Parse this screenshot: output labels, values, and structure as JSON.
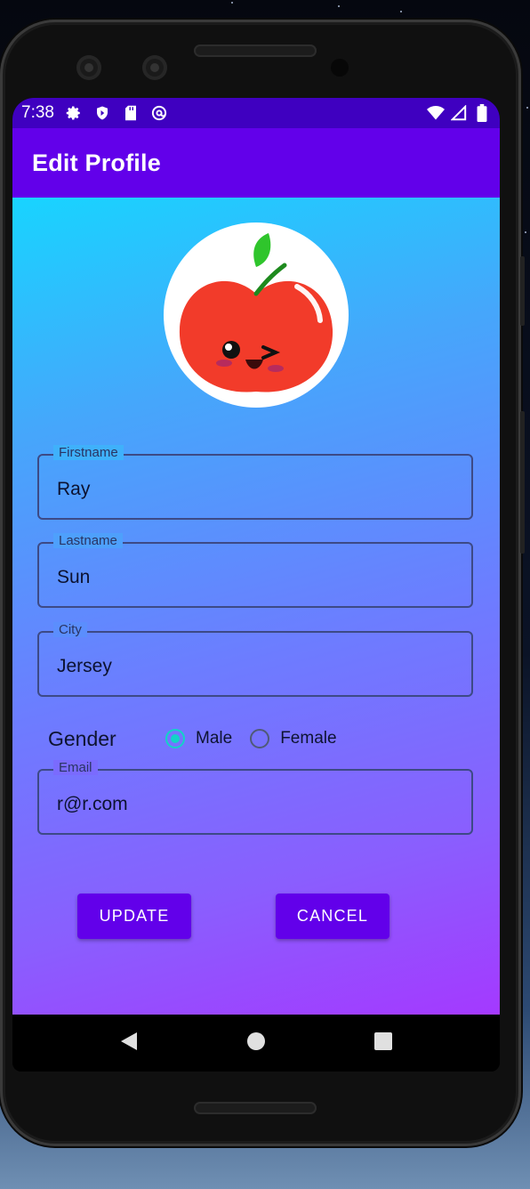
{
  "status_bar": {
    "time": "7:38",
    "left_icons": [
      "gear-icon",
      "shield-icon",
      "sd-card-icon",
      "at-sign-icon"
    ],
    "right_icons": [
      "wifi-icon",
      "signal-icon",
      "battery-icon"
    ]
  },
  "app_bar": {
    "title": "Edit Profile"
  },
  "avatar": {
    "icon": "apple-avatar-icon"
  },
  "form": {
    "firstname": {
      "label": "Firstname",
      "value": "Ray"
    },
    "lastname": {
      "label": "Lastname",
      "value": "Sun"
    },
    "city": {
      "label": "City",
      "value": "Jersey"
    },
    "gender": {
      "label": "Gender",
      "options": [
        {
          "label": "Male",
          "selected": true
        },
        {
          "label": "Female",
          "selected": false
        }
      ]
    },
    "email": {
      "label": "Email",
      "value": "r@r.com"
    }
  },
  "actions": {
    "update_label": "UPDATE",
    "cancel_label": "CANCEL"
  },
  "nav_bar": {
    "icons": [
      "back-icon",
      "home-icon",
      "recents-icon"
    ]
  },
  "colors": {
    "app_bar": "#6200ea",
    "status_bar": "#3f00c0",
    "accent": "#12d3c7",
    "gradient_top": "#18d4ff",
    "gradient_bottom": "#a439ff"
  }
}
